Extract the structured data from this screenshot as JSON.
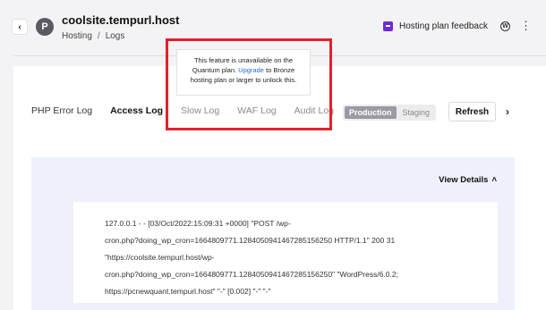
{
  "header": {
    "back_glyph": "‹",
    "avatar_letter": "P",
    "site_title": "coolsite.tempurl.host",
    "breadcrumb": [
      "Hosting",
      "/",
      "Logs"
    ],
    "feedback_label": "Hosting plan feedback",
    "wp_glyph": "W",
    "kebab_glyph": "⋮"
  },
  "tabs": [
    {
      "label": "PHP Error Log",
      "state": "normal"
    },
    {
      "label": "Access Log",
      "state": "active"
    },
    {
      "label": "Slow Log",
      "state": "disabled"
    },
    {
      "label": "WAF Log",
      "state": "disabled"
    },
    {
      "label": "Audit Log",
      "state": "disabled"
    }
  ],
  "environment": {
    "options": [
      "Production",
      "Staging"
    ],
    "selected": "Production"
  },
  "toolbar": {
    "refresh_label": "Refresh",
    "next_glyph": "›"
  },
  "tooltip": {
    "text_before": "This feature is unavailable on the Quantum plan. ",
    "link_text": "Upgrade",
    "text_after": " to Bronze hosting plan or larger to unlock this."
  },
  "log": {
    "view_details_label": "View Details",
    "view_details_glyph": "˄",
    "lines": [
      "127.0.0.1 - - [03/Oct/2022:15:09:31 +0000] \"POST /wp-",
      "cron.php?doing_wp_cron=1664809771.1284050941467285156250 HTTP/1.1\" 200 31",
      "\"https://coolsite.tempurl.host/wp-",
      "cron.php?doing_wp_cron=1664809771.1284050941467285156250\" \"WordPress/6.0.2;",
      "https://pcnewquant.tempurl.host\" \"-\" [0.002] \"-\" \"-\""
    ]
  },
  "colors": {
    "accent_purple": "#6c2bd9",
    "link_blue": "#1e6fd9",
    "highlight_red": "#e3212b"
  }
}
